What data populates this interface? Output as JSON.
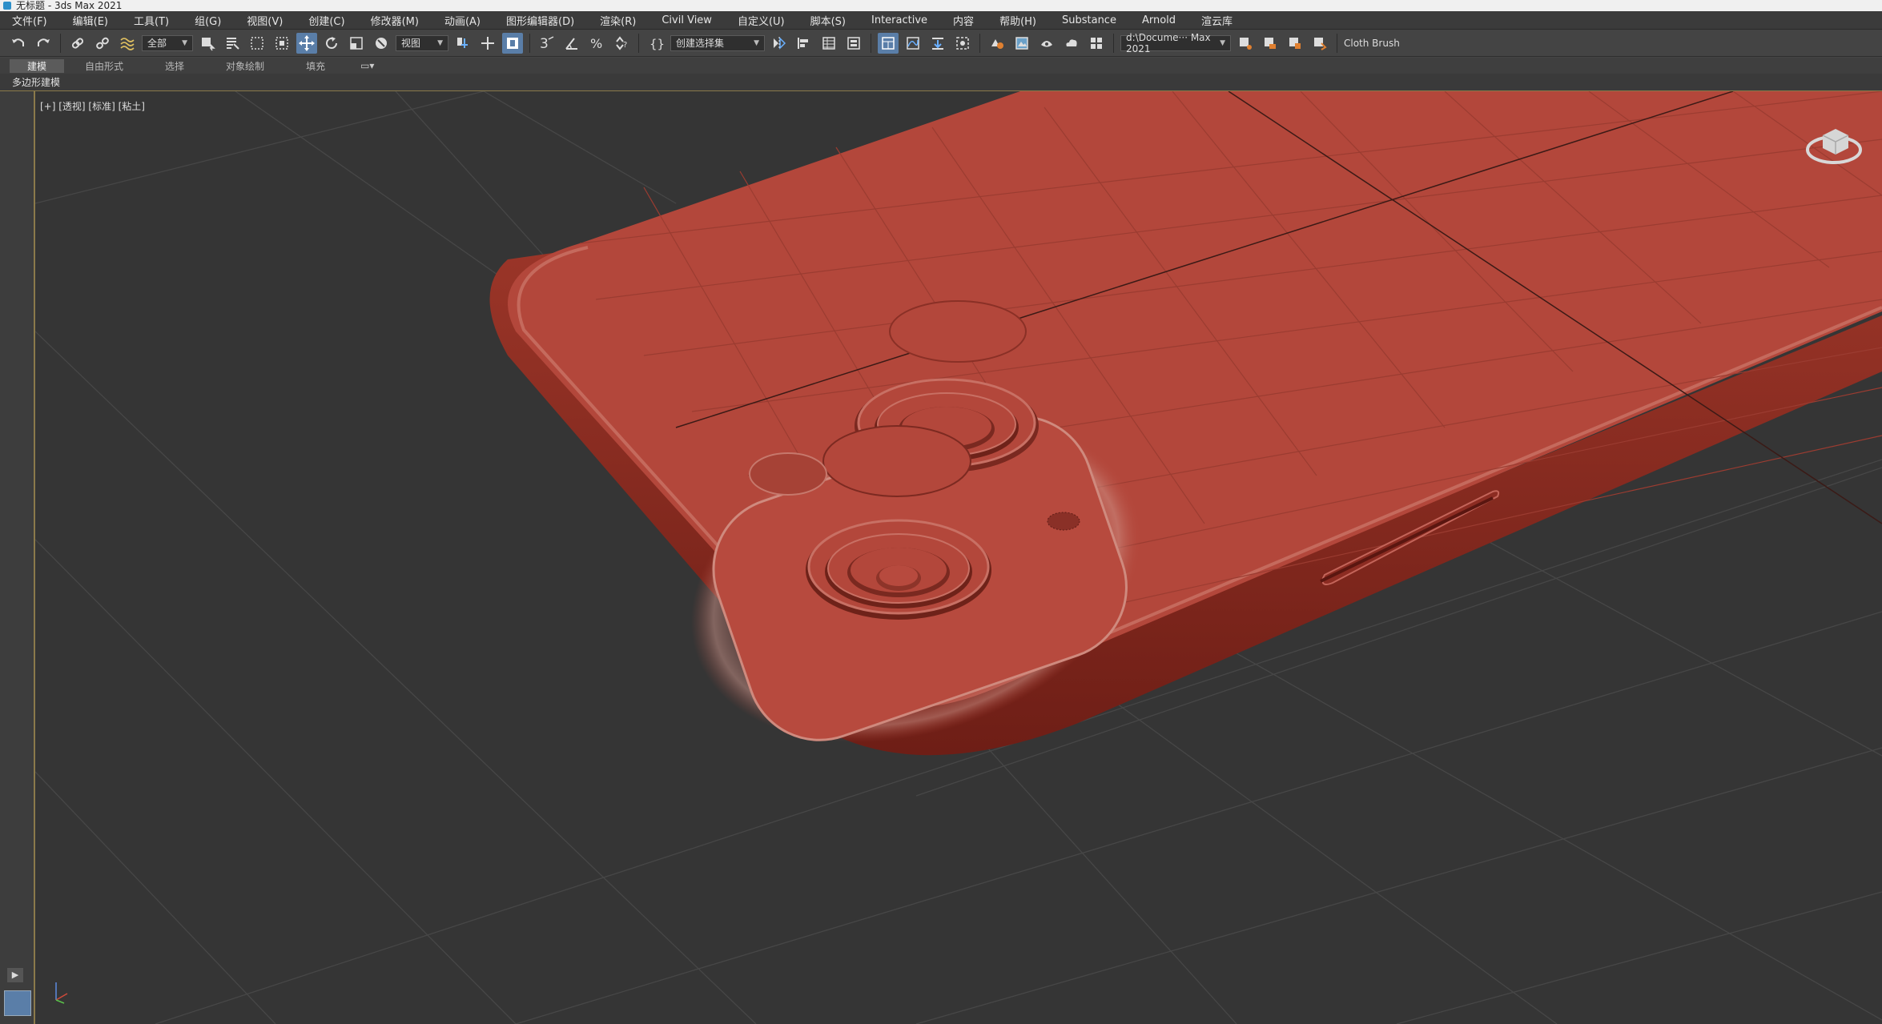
{
  "window": {
    "title": "无标题 - 3ds Max 2021"
  },
  "menu": {
    "items": [
      "文件(F)",
      "编辑(E)",
      "工具(T)",
      "组(G)",
      "视图(V)",
      "创建(C)",
      "修改器(M)",
      "动画(A)",
      "图形编辑器(D)",
      "渲染(R)",
      "Civil View",
      "自定义(U)",
      "脚本(S)",
      "Interactive",
      "内容",
      "帮助(H)",
      "Substance",
      "Arnold",
      "渲云库"
    ]
  },
  "toolbar": {
    "selection_filter": "全部",
    "reference_coord": "视图",
    "named_selection": "创建选择集",
    "snap_label": "3",
    "project_path": "d:\\Docume··· Max 2021",
    "cloth_brush": "Cloth Brush"
  },
  "ribbon": {
    "tabs": [
      "建模",
      "自由形式",
      "选择",
      "对象绘制",
      "填充"
    ],
    "active_tab": "建模",
    "subtitle": "多边形建模"
  },
  "viewport": {
    "label": "[+] [透视] [标准] [粘土]",
    "background_color": "#353535",
    "model_color": "#b3473b"
  },
  "colors": {
    "accent": "#5a7ea8",
    "viewport_border": "#8b7a4a"
  }
}
